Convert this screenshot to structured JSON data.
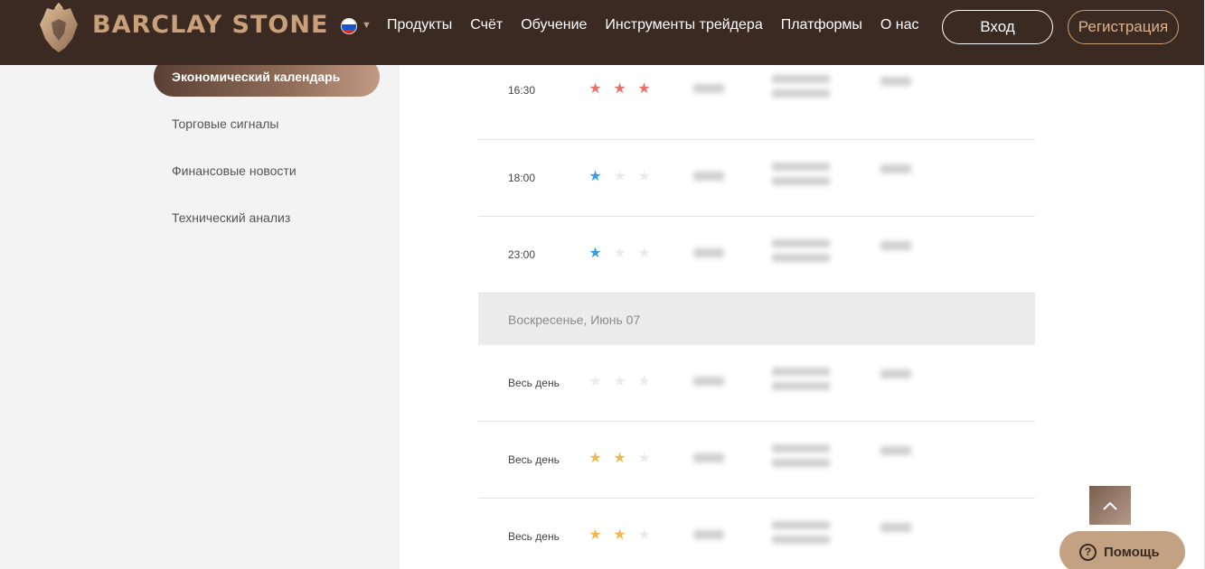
{
  "header": {
    "brand": "BARCLAY STONE",
    "nav": [
      "Продукты",
      "Счёт",
      "Обучение",
      "Инструменты трейдера",
      "Платформы",
      "О нас"
    ],
    "login": "Вход",
    "register": "Регистрация",
    "flag_icon": "russian-flag-icon",
    "colors": {
      "bar": "#3a2a22",
      "accent": "#c9a07a"
    }
  },
  "sidebar": {
    "items": [
      {
        "label": "Экономический календарь",
        "active": true
      },
      {
        "label": "Торговые сигналы",
        "active": false
      },
      {
        "label": "Финансовые новости",
        "active": false
      },
      {
        "label": "Технический анализ",
        "active": false
      }
    ]
  },
  "calendar": {
    "rows_before": [
      {
        "time": "16:30",
        "stars": 3,
        "color": "#e9716b"
      },
      {
        "time": "18:00",
        "stars": 1,
        "color": "#3d9be0"
      },
      {
        "time": "23:00",
        "stars": 1,
        "color": "#3d9be0"
      }
    ],
    "day_header": "Воскресенье, Июнь 07",
    "rows_after": [
      {
        "time": "Весь день",
        "stars": 0,
        "color": "#ebebeb"
      },
      {
        "time": "Весь день",
        "stars": 2,
        "color": "#f0b84e"
      },
      {
        "time": "Весь день",
        "stars": 2,
        "color": "#f0b84e"
      }
    ],
    "star_empty_color": "#ebebeb"
  },
  "floating": {
    "scroll_top_icon": "chevron-up-icon",
    "help_label": "Помощь",
    "help_icon": "question-icon"
  }
}
